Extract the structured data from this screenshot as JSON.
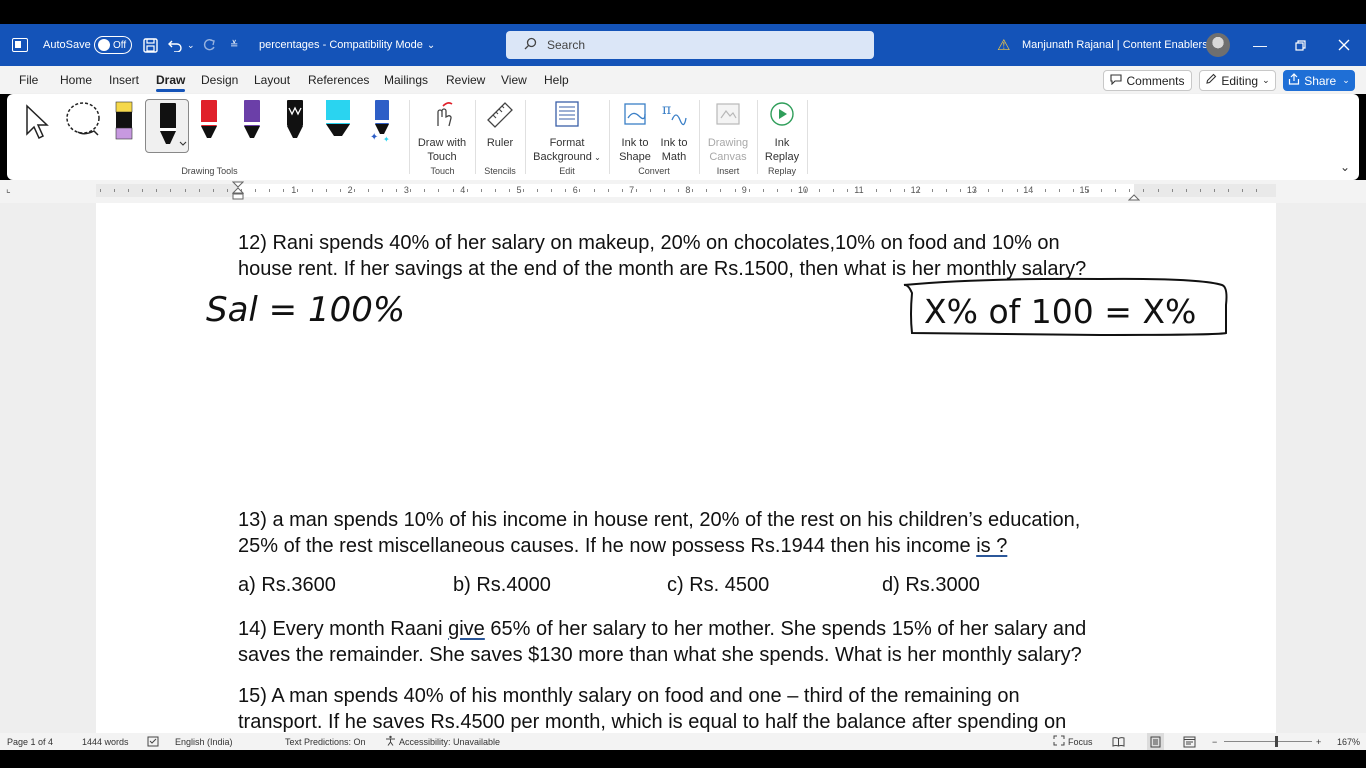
{
  "titlebar": {
    "autosave_label": "AutoSave",
    "autosave_state": "Off",
    "document_title": "percentages  -  Compatibility Mode",
    "search_placeholder": "Search",
    "user_name": "Manjunath Rajanal | Content Enablers"
  },
  "menu": {
    "tabs": [
      "File",
      "Home",
      "Insert",
      "Draw",
      "Design",
      "Layout",
      "References",
      "Mailings",
      "Review",
      "View",
      "Help"
    ],
    "active_tab": "Draw",
    "comments_label": "Comments",
    "editing_label": "Editing",
    "share_label": "Share"
  },
  "ribbon": {
    "pens": [
      {
        "name": "highlighter-yellow",
        "color": "#f5d84a"
      },
      {
        "name": "pen-black-selected",
        "color": "#111111"
      },
      {
        "name": "pen-red",
        "color": "#e0202a"
      },
      {
        "name": "pen-purple",
        "color": "#6b3fa8"
      },
      {
        "name": "pen-black-pattern",
        "color": "#111111"
      },
      {
        "name": "highlighter-cyan",
        "color": "#2ad4f0"
      },
      {
        "name": "pen-galaxy",
        "color": "#2e5fc7"
      }
    ],
    "buttons": {
      "draw_with_touch": "Draw with\nTouch",
      "ruler": "Ruler",
      "format_background": "Format\nBackground",
      "ink_to_shape": "Ink to\nShape",
      "ink_to_math": "Ink to\nMath",
      "drawing_canvas": "Drawing\nCanvas",
      "ink_replay": "Ink\nReplay"
    },
    "groups": {
      "drawing_tools": "Drawing Tools",
      "touch": "Touch",
      "stencils": "Stencils",
      "edit": "Edit",
      "convert": "Convert",
      "insert": "Insert",
      "replay": "Replay"
    }
  },
  "ruler": {
    "numbers": [
      "1",
      "2",
      "3",
      "4",
      "5",
      "6",
      "7",
      "8",
      "9",
      "10",
      "11",
      "12",
      "13",
      "14",
      "15"
    ]
  },
  "document": {
    "q12_line1": "12) Rani spends 40% of her salary on makeup, 20% on chocolates,10% on food and 10% on",
    "q12_line2": "house rent. If her savings at the end of the month are Rs.1500, then what is her monthly salary?",
    "ink_left": "Sal = 100%",
    "ink_right": "X% of 100 = X%",
    "q13_line1": "13) a man spends 10% of his income in house rent, 20% of the rest on his children’s education,",
    "q13_line2_pre": "25% of the rest miscellaneous causes. If he now possess Rs.1944 then his income ",
    "q13_line2_ul": "is ?",
    "options": {
      "a": "a) Rs.3600",
      "b": "b) Rs.4000",
      "c": "c) Rs. 4500",
      "d": "d) Rs.3000"
    },
    "q14_line1_pre": "14) Every month Raani ",
    "q14_line1_ul": "give",
    "q14_line1_post": " 65% of her salary to her mother. She spends 15% of her salary and",
    "q14_line2": "saves the remainder. She saves $130 more than what she spends. What is her monthly salary?",
    "q15_line1": "15) A man spends 40% of his monthly salary on food and one – third of the remaining on",
    "q15_line2": "transport. If he saves Rs.4500 per month, which is equal to half the balance after spending on"
  },
  "statusbar": {
    "page": "Page 1 of 4",
    "words": "1444 words",
    "language": "English (India)",
    "text_predictions": "Text Predictions: On",
    "accessibility": "Accessibility: Unavailable",
    "focus": "Focus",
    "zoom": "167%"
  }
}
